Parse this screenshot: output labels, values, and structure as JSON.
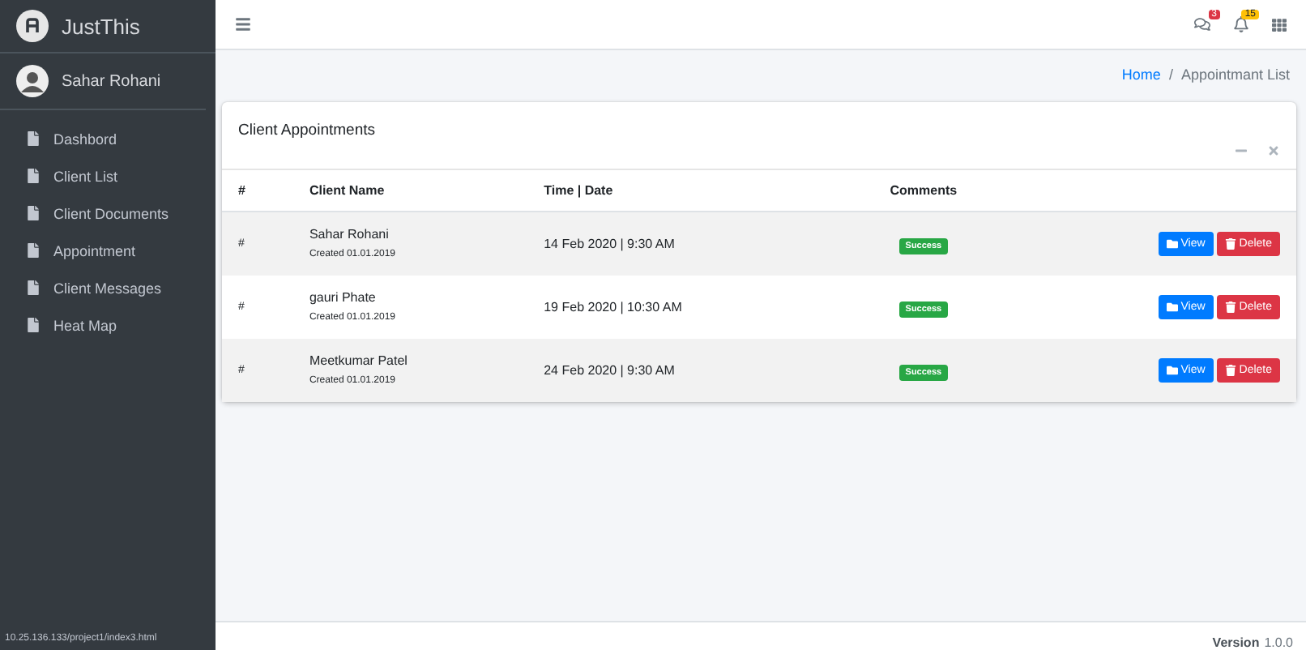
{
  "brand": {
    "name": "JustThis"
  },
  "user": {
    "name": "Sahar Rohani"
  },
  "sidebar": {
    "items": [
      {
        "label": "Dashbord",
        "selected": false
      },
      {
        "label": "Client List",
        "selected": false
      },
      {
        "label": "Client Documents",
        "selected": false
      },
      {
        "label": "Appointment",
        "selected": false
      },
      {
        "label": "Client Messages",
        "selected": false
      },
      {
        "label": "Heat Map",
        "selected": false
      }
    ]
  },
  "topbar": {
    "messages_badge": "3",
    "notifications_badge": "15"
  },
  "breadcrumb": [
    {
      "label": "Home",
      "kind": "link"
    },
    {
      "label": "/",
      "kind": "separator"
    },
    {
      "label": "Appointmant List",
      "kind": "current"
    }
  ],
  "card": {
    "title": "Client Appointments",
    "table": {
      "columns": [
        "#",
        "Client Name",
        "Time | Date",
        "Comments"
      ],
      "rows": [
        {
          "index": "#",
          "name": "Sahar Rohani",
          "created": "Created 01.01.2019",
          "time": "14 Feb 2020 | 9:30 AM",
          "status": "Success",
          "actions": [
            "View",
            "Delete"
          ]
        },
        {
          "index": "#",
          "name": "gauri Phate",
          "created": "Created 01.01.2019",
          "time": "19 Feb 2020 | 10:30 AM",
          "status": "Success",
          "actions": [
            "View",
            "Delete"
          ]
        },
        {
          "index": "#",
          "name": "Meetkumar Patel",
          "created": "Created 01.01.2019",
          "time": "24 Feb 2020 | 9:30 AM",
          "status": "Success",
          "actions": [
            "View",
            "Delete"
          ]
        }
      ]
    }
  },
  "footer": {
    "version_label": "Version",
    "version": "1.0.0"
  },
  "status_bar": {
    "url": "10.25.136.133/project1/index3.html"
  }
}
